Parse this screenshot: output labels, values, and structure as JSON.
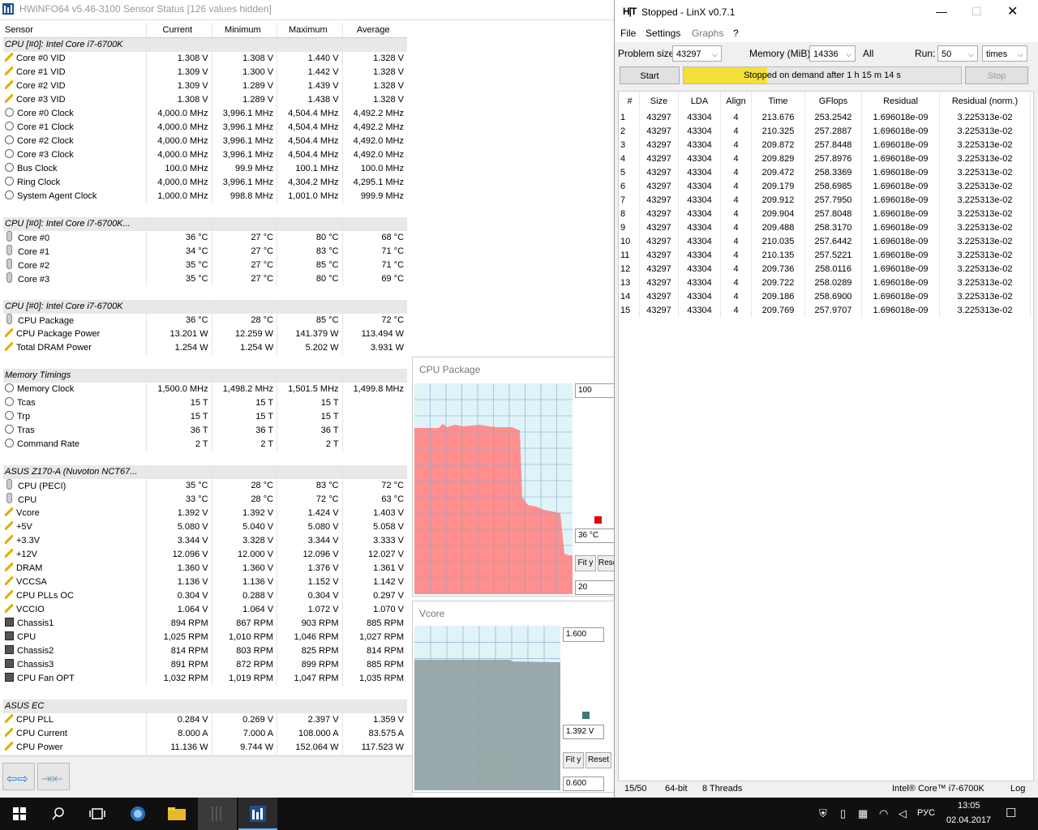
{
  "hwinfo": {
    "title": "HWiNFO64 v5.46-3100 Sensor Status [126 values hidden]",
    "headers": [
      "Sensor",
      "Current",
      "Minimum",
      "Maximum",
      "Average"
    ],
    "rows": [
      {
        "t": "g",
        "n": "CPU [#0]: Intel Core i7-6700K"
      },
      {
        "t": "r",
        "i": "volt",
        "n": "Core #0 VID",
        "v": [
          "1.308 V",
          "1.308 V",
          "1.440 V",
          "1.328 V"
        ]
      },
      {
        "t": "r",
        "i": "volt",
        "n": "Core #1 VID",
        "v": [
          "1.309 V",
          "1.300 V",
          "1.442 V",
          "1.328 V"
        ]
      },
      {
        "t": "r",
        "i": "volt",
        "n": "Core #2 VID",
        "v": [
          "1.309 V",
          "1.289 V",
          "1.439 V",
          "1.328 V"
        ]
      },
      {
        "t": "r",
        "i": "volt",
        "n": "Core #3 VID",
        "v": [
          "1.308 V",
          "1.289 V",
          "1.438 V",
          "1.328 V"
        ]
      },
      {
        "t": "r",
        "i": "clock",
        "n": "Core #0 Clock",
        "v": [
          "4,000.0 MHz",
          "3,996.1 MHz",
          "4,504.4 MHz",
          "4,492.2 MHz"
        ]
      },
      {
        "t": "r",
        "i": "clock",
        "n": "Core #1 Clock",
        "v": [
          "4,000.0 MHz",
          "3,996.1 MHz",
          "4,504.4 MHz",
          "4,492.2 MHz"
        ]
      },
      {
        "t": "r",
        "i": "clock",
        "n": "Core #2 Clock",
        "v": [
          "4,000.0 MHz",
          "3,996.1 MHz",
          "4,504.4 MHz",
          "4,492.0 MHz"
        ]
      },
      {
        "t": "r",
        "i": "clock",
        "n": "Core #3 Clock",
        "v": [
          "4,000.0 MHz",
          "3,996.1 MHz",
          "4,504.4 MHz",
          "4,492.0 MHz"
        ]
      },
      {
        "t": "r",
        "i": "clock",
        "n": "Bus Clock",
        "v": [
          "100.0 MHz",
          "99.9 MHz",
          "100.1 MHz",
          "100.0 MHz"
        ]
      },
      {
        "t": "r",
        "i": "clock",
        "n": "Ring Clock",
        "v": [
          "4,000.0 MHz",
          "3,996.1 MHz",
          "4,304.2 MHz",
          "4,295.1 MHz"
        ]
      },
      {
        "t": "r",
        "i": "clock",
        "n": "System Agent Clock",
        "v": [
          "1,000.0 MHz",
          "998.8 MHz",
          "1,001.0 MHz",
          "999.9 MHz"
        ]
      },
      {
        "t": "s"
      },
      {
        "t": "g",
        "n": "CPU [#0]: Intel Core i7-6700K..."
      },
      {
        "t": "r",
        "i": "temp",
        "n": "Core #0",
        "v": [
          "36 °C",
          "27 °C",
          "80 °C",
          "68 °C"
        ]
      },
      {
        "t": "r",
        "i": "temp",
        "n": "Core #1",
        "v": [
          "34 °C",
          "27 °C",
          "83 °C",
          "71 °C"
        ]
      },
      {
        "t": "r",
        "i": "temp",
        "n": "Core #2",
        "v": [
          "35 °C",
          "27 °C",
          "85 °C",
          "71 °C"
        ]
      },
      {
        "t": "r",
        "i": "temp",
        "n": "Core #3",
        "v": [
          "35 °C",
          "27 °C",
          "80 °C",
          "69 °C"
        ]
      },
      {
        "t": "s"
      },
      {
        "t": "g",
        "n": "CPU [#0]: Intel Core i7-6700K"
      },
      {
        "t": "r",
        "i": "temp",
        "n": "CPU Package",
        "v": [
          "36 °C",
          "28 °C",
          "85 °C",
          "72 °C"
        ]
      },
      {
        "t": "r",
        "i": "volt",
        "n": "CPU Package Power",
        "v": [
          "13.201 W",
          "12.259 W",
          "141.379 W",
          "113.494 W"
        ]
      },
      {
        "t": "r",
        "i": "volt",
        "n": "Total DRAM Power",
        "v": [
          "1.254 W",
          "1.254 W",
          "5.202 W",
          "3.931 W"
        ]
      },
      {
        "t": "s"
      },
      {
        "t": "g",
        "n": "Memory Timings"
      },
      {
        "t": "r",
        "i": "clock",
        "n": "Memory Clock",
        "v": [
          "1,500.0 MHz",
          "1,498.2 MHz",
          "1,501.5 MHz",
          "1,499.8 MHz"
        ]
      },
      {
        "t": "r",
        "i": "clock",
        "n": "Tcas",
        "v": [
          "15 T",
          "15 T",
          "15 T",
          ""
        ]
      },
      {
        "t": "r",
        "i": "clock",
        "n": "Trp",
        "v": [
          "15 T",
          "15 T",
          "15 T",
          ""
        ]
      },
      {
        "t": "r",
        "i": "clock",
        "n": "Tras",
        "v": [
          "36 T",
          "36 T",
          "36 T",
          ""
        ]
      },
      {
        "t": "r",
        "i": "clock",
        "n": "Command Rate",
        "v": [
          "2 T",
          "2 T",
          "2 T",
          ""
        ]
      },
      {
        "t": "s"
      },
      {
        "t": "g",
        "n": "ASUS Z170-A (Nuvoton NCT67..."
      },
      {
        "t": "r",
        "i": "temp",
        "n": "CPU (PECI)",
        "v": [
          "35 °C",
          "28 °C",
          "83 °C",
          "72 °C"
        ]
      },
      {
        "t": "r",
        "i": "temp",
        "n": "CPU",
        "v": [
          "33 °C",
          "28 °C",
          "72 °C",
          "63 °C"
        ]
      },
      {
        "t": "r",
        "i": "volt",
        "n": "Vcore",
        "v": [
          "1.392 V",
          "1.392 V",
          "1.424 V",
          "1.403 V"
        ]
      },
      {
        "t": "r",
        "i": "volt",
        "n": "+5V",
        "v": [
          "5.080 V",
          "5.040 V",
          "5.080 V",
          "5.058 V"
        ]
      },
      {
        "t": "r",
        "i": "volt",
        "n": "+3.3V",
        "v": [
          "3.344 V",
          "3.328 V",
          "3.344 V",
          "3.333 V"
        ]
      },
      {
        "t": "r",
        "i": "volt",
        "n": "+12V",
        "v": [
          "12.096 V",
          "12.000 V",
          "12.096 V",
          "12.027 V"
        ]
      },
      {
        "t": "r",
        "i": "volt",
        "n": "DRAM",
        "v": [
          "1.360 V",
          "1.360 V",
          "1.376 V",
          "1.361 V"
        ]
      },
      {
        "t": "r",
        "i": "volt",
        "n": "VCCSA",
        "v": [
          "1.136 V",
          "1.136 V",
          "1.152 V",
          "1.142 V"
        ]
      },
      {
        "t": "r",
        "i": "volt",
        "n": "CPU PLLs OC",
        "v": [
          "0.304 V",
          "0.288 V",
          "0.304 V",
          "0.297 V"
        ]
      },
      {
        "t": "r",
        "i": "volt",
        "n": "VCCIO",
        "v": [
          "1.064 V",
          "1.064 V",
          "1.072 V",
          "1.070 V"
        ]
      },
      {
        "t": "r",
        "i": "fan",
        "n": "Chassis1",
        "v": [
          "894 RPM",
          "867 RPM",
          "903 RPM",
          "885 RPM"
        ]
      },
      {
        "t": "r",
        "i": "fan",
        "n": "CPU",
        "v": [
          "1,025 RPM",
          "1,010 RPM",
          "1,046 RPM",
          "1,027 RPM"
        ]
      },
      {
        "t": "r",
        "i": "fan",
        "n": "Chassis2",
        "v": [
          "814 RPM",
          "803 RPM",
          "825 RPM",
          "814 RPM"
        ]
      },
      {
        "t": "r",
        "i": "fan",
        "n": "Chassis3",
        "v": [
          "891 RPM",
          "872 RPM",
          "899 RPM",
          "885 RPM"
        ]
      },
      {
        "t": "r",
        "i": "fan",
        "n": "CPU Fan OPT",
        "v": [
          "1,032 RPM",
          "1,019 RPM",
          "1,047 RPM",
          "1,035 RPM"
        ]
      },
      {
        "t": "s"
      },
      {
        "t": "g",
        "n": "ASUS EC"
      },
      {
        "t": "r",
        "i": "volt",
        "n": "CPU PLL",
        "v": [
          "0.284 V",
          "0.269 V",
          "2.397 V",
          "1.359 V"
        ]
      },
      {
        "t": "r",
        "i": "volt",
        "n": "CPU Current",
        "v": [
          "8.000 A",
          "7.000 A",
          "108.000 A",
          "83.575 A"
        ]
      },
      {
        "t": "r",
        "i": "volt",
        "n": "CPU Power",
        "v": [
          "11.136 W",
          "9.744 W",
          "152.064 W",
          "117.523 W"
        ]
      }
    ]
  },
  "graph_cpu": {
    "title": "CPU Package",
    "top": "100",
    "current": "36 °C",
    "bottom": "20",
    "fit": "Fit y",
    "reset": "Reset",
    "color": "#ff8f8f",
    "marker": "#e00000"
  },
  "graph_vcore": {
    "title": "Vcore",
    "top": "1.600",
    "current": "1.392 V",
    "bottom": "0.600",
    "fit": "Fit y",
    "reset": "Reset",
    "color": "#9aa9a9",
    "marker": "#3c7a7a"
  },
  "linx": {
    "title": "Stopped - LinX v0.7.1",
    "logo": "H|T",
    "menu": [
      "File",
      "Settings",
      "Graphs",
      "?"
    ],
    "problem_label": "Problem size:",
    "problem_value": "43297",
    "memory_label": "Memory (MiB):",
    "memory_value": "14336",
    "all_label": "All",
    "run_label": "Run:",
    "run_value": "50",
    "run_unit": "times",
    "start": "Start",
    "stop": "Stop",
    "progress_text": "Stopped on demand after 1 h 15 m 14 s",
    "progress_fraction": 0.3,
    "headers": [
      "#",
      "Size",
      "LDA",
      "Align",
      "Time",
      "GFlops",
      "Residual",
      "Residual (norm.)"
    ],
    "rows": [
      [
        "1",
        "43297",
        "43304",
        "4",
        "213.676",
        "253.2542",
        "1.696018e-09",
        "3.225313e-02"
      ],
      [
        "2",
        "43297",
        "43304",
        "4",
        "210.325",
        "257.2887",
        "1.696018e-09",
        "3.225313e-02"
      ],
      [
        "3",
        "43297",
        "43304",
        "4",
        "209.872",
        "257.8448",
        "1.696018e-09",
        "3.225313e-02"
      ],
      [
        "4",
        "43297",
        "43304",
        "4",
        "209.829",
        "257.8976",
        "1.696018e-09",
        "3.225313e-02"
      ],
      [
        "5",
        "43297",
        "43304",
        "4",
        "209.472",
        "258.3369",
        "1.696018e-09",
        "3.225313e-02"
      ],
      [
        "6",
        "43297",
        "43304",
        "4",
        "209.179",
        "258.6985",
        "1.696018e-09",
        "3.225313e-02"
      ],
      [
        "7",
        "43297",
        "43304",
        "4",
        "209.912",
        "257.7950",
        "1.696018e-09",
        "3.225313e-02"
      ],
      [
        "8",
        "43297",
        "43304",
        "4",
        "209.904",
        "257.8048",
        "1.696018e-09",
        "3.225313e-02"
      ],
      [
        "9",
        "43297",
        "43304",
        "4",
        "209.488",
        "258.3170",
        "1.696018e-09",
        "3.225313e-02"
      ],
      [
        "10",
        "43297",
        "43304",
        "4",
        "210.035",
        "257.6442",
        "1.696018e-09",
        "3.225313e-02"
      ],
      [
        "11",
        "43297",
        "43304",
        "4",
        "210.135",
        "257.5221",
        "1.696018e-09",
        "3.225313e-02"
      ],
      [
        "12",
        "43297",
        "43304",
        "4",
        "209.736",
        "258.0116",
        "1.696018e-09",
        "3.225313e-02"
      ],
      [
        "13",
        "43297",
        "43304",
        "4",
        "209.722",
        "258.0289",
        "1.696018e-09",
        "3.225313e-02"
      ],
      [
        "14",
        "43297",
        "43304",
        "4",
        "209.186",
        "258.6900",
        "1.696018e-09",
        "3.225313e-02"
      ],
      [
        "15",
        "43297",
        "43304",
        "4",
        "209.769",
        "257.9707",
        "1.696018e-09",
        "3.225313e-02"
      ]
    ],
    "status": {
      "runs": "15/50",
      "bits": "64-bit",
      "threads": "8 Threads",
      "cpu": "Intel® Core™ i7-6700K",
      "log": "Log"
    }
  },
  "taskbar": {
    "lang": "РУС",
    "time": "13:05",
    "date": "02.04.2017"
  }
}
